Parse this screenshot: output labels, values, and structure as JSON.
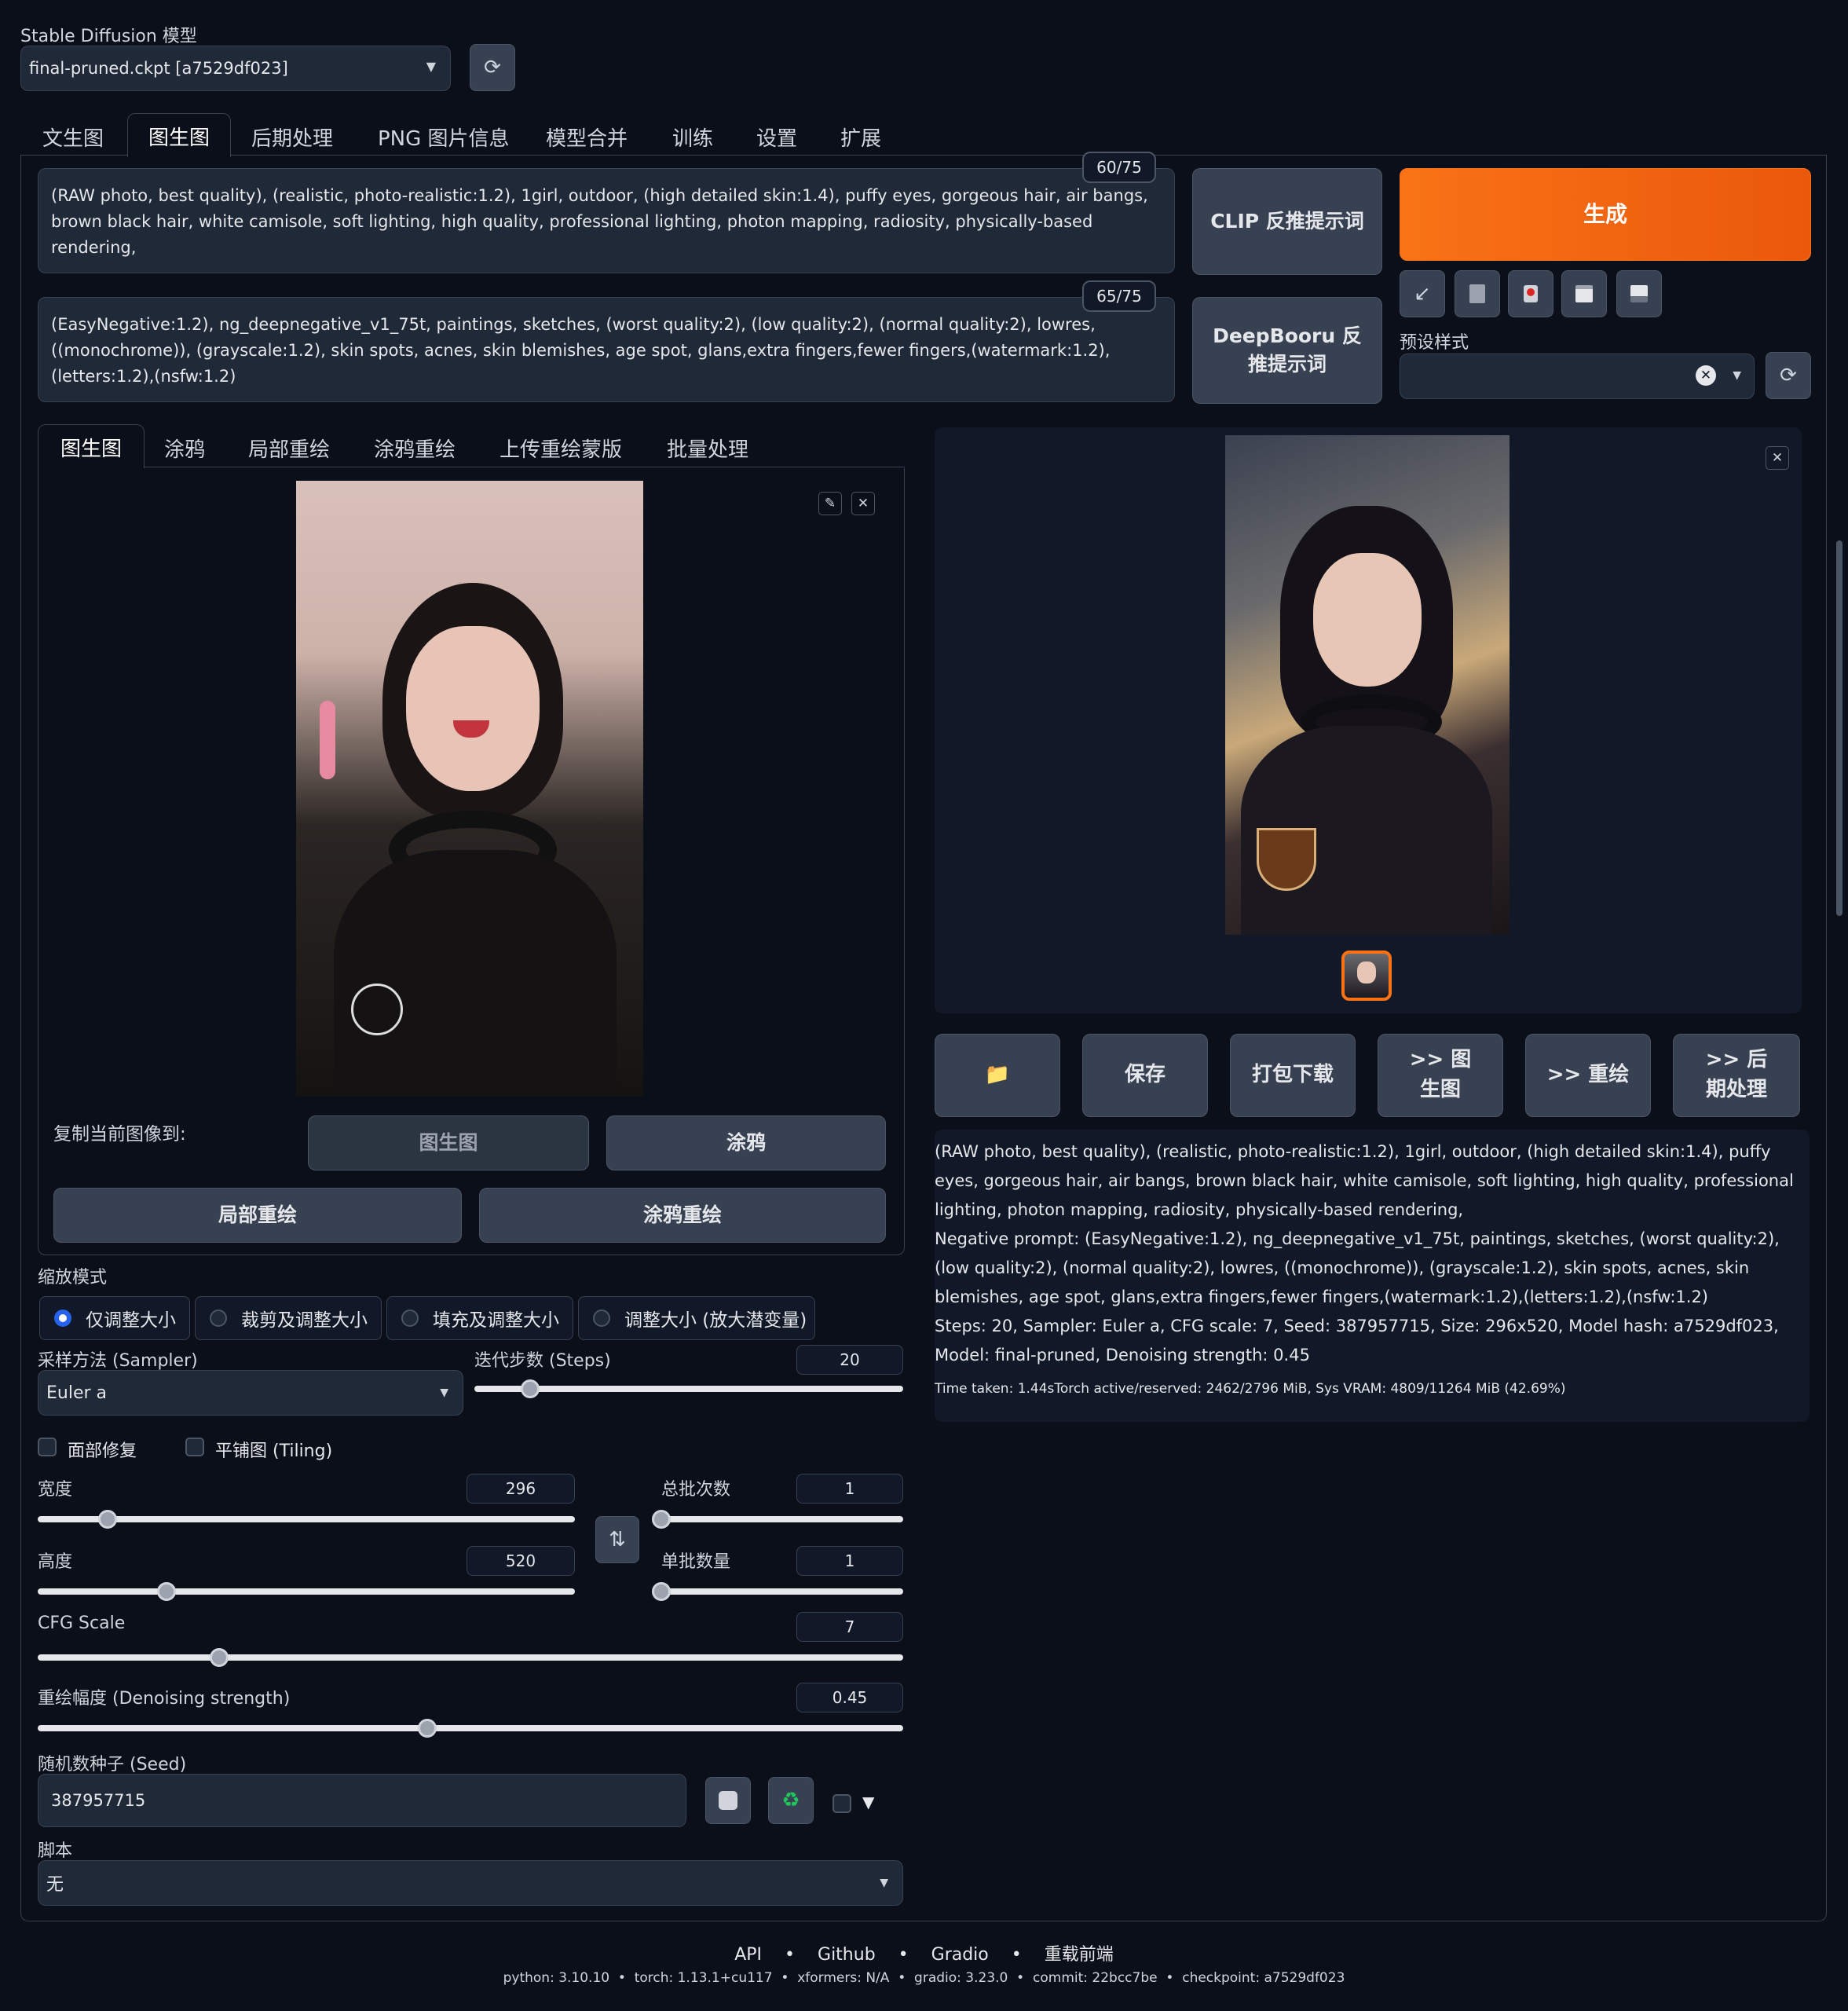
{
  "model": {
    "label": "Stable Diffusion 模型",
    "value": "final-pruned.ckpt [a7529df023]"
  },
  "main_tabs": [
    "文生图",
    "图生图",
    "后期处理",
    "PNG 图片信息",
    "模型合并",
    "训练",
    "设置",
    "扩展"
  ],
  "prompt": {
    "text": "(RAW photo, best quality), (realistic, photo-realistic:1.2), 1girl,  outdoor, (high detailed skin:1.4), puffy eyes, gorgeous hair, air bangs, brown black hair, white camisole, soft lighting, high quality, professional lighting, photon mapping, radiosity, physically-based rendering,",
    "counter": "60/75"
  },
  "negative_prompt": {
    "text": "(EasyNegative:1.2), ng_deepnegative_v1_75t, paintings, sketches, (worst quality:2), (low quality:2), (normal quality:2), lowres, ((monochrome)), (grayscale:1.2), skin spots, acnes, skin blemishes, age spot, glans,extra fingers,fewer fingers,(watermark:1.2),(letters:1.2),(nsfw:1.2)",
    "counter": "65/75"
  },
  "interrogate": {
    "clip": "CLIP 反推提示词",
    "deepbooru": "DeepBooru 反推提示词"
  },
  "generate": {
    "label": "生成",
    "color": "#f97316"
  },
  "tool_icons": [
    "arrow-icon",
    "trash-icon",
    "style-icon",
    "clipboard-icon",
    "save-icon"
  ],
  "styles": {
    "label": "预设样式"
  },
  "sub_tabs": [
    "图生图",
    "涂鸦",
    "局部重绘",
    "涂鸦重绘",
    "上传重绘蒙版",
    "批量处理"
  ],
  "copy_to": {
    "label": "复制当前图像到:",
    "buttons": [
      "图生图",
      "涂鸦",
      "局部重绘",
      "涂鸦重绘"
    ]
  },
  "resize_mode": {
    "label": "缩放模式",
    "options": [
      "仅调整大小",
      "裁剪及调整大小",
      "填充及调整大小",
      "调整大小 (放大潜变量)"
    ],
    "selected": 0
  },
  "sampler": {
    "label": "采样方法 (Sampler)",
    "value": "Euler a"
  },
  "steps": {
    "label": "迭代步数 (Steps)",
    "value": "20",
    "fraction": 0.13
  },
  "face_restore": "面部修复",
  "tiling": "平铺图 (Tiling)",
  "width": {
    "label": "宽度",
    "value": "296",
    "fraction": 0.13
  },
  "height": {
    "label": "高度",
    "value": "520",
    "fraction": 0.24
  },
  "batch_count": {
    "label": "总批次数",
    "value": "1",
    "fraction": 0.0
  },
  "batch_size": {
    "label": "单批数量",
    "value": "1",
    "fraction": 0.0
  },
  "cfg": {
    "label": "CFG Scale",
    "value": "7",
    "fraction": 0.21
  },
  "denoise": {
    "label": "重绘幅度 (Denoising strength)",
    "value": "0.45",
    "fraction": 0.45
  },
  "seed": {
    "label": "随机数种子 (Seed)",
    "value": "387957715"
  },
  "script": {
    "label": "脚本",
    "value": "无"
  },
  "output_buttons": [
    "📁",
    "保存",
    "打包下载",
    ">> 图生图",
    ">> 重绘",
    ">> 后期处理"
  ],
  "info": {
    "line1": "(RAW photo, best quality), (realistic, photo-realistic:1.2), 1girl, outdoor, (high detailed skin:1.4), puffy eyes, gorgeous hair, air bangs, brown black hair, white camisole, soft lighting, high quality, professional lighting, photon mapping, radiosity, physically-based rendering,",
    "line2": "Negative prompt: (EasyNegative:1.2), ng_deepnegative_v1_75t, paintings, sketches, (worst quality:2), (low quality:2), (normal quality:2), lowres, ((monochrome)), (grayscale:1.2), skin spots, acnes, skin blemishes, age spot, glans,extra fingers,fewer fingers,(watermark:1.2),(letters:1.2),(nsfw:1.2)",
    "line3": "Steps: 20, Sampler: Euler a, CFG scale: 7, Seed: 387957715, Size: 296x520, Model hash: a7529df023, Model: final-pruned, Denoising strength: 0.45",
    "time": "Time taken: 1.44sTorch active/reserved: 2462/2796 MiB, Sys VRAM: 4809/11264 MiB (42.69%)"
  },
  "footer": {
    "links": [
      "API",
      "Github",
      "Gradio",
      "重载前端"
    ],
    "versions": "python: 3.10.10  •  torch: 1.13.1+cu117  •  xformers: N/A  •  gradio: 3.23.0  •  commit: 22bcc7be  •  checkpoint: a7529df023"
  }
}
